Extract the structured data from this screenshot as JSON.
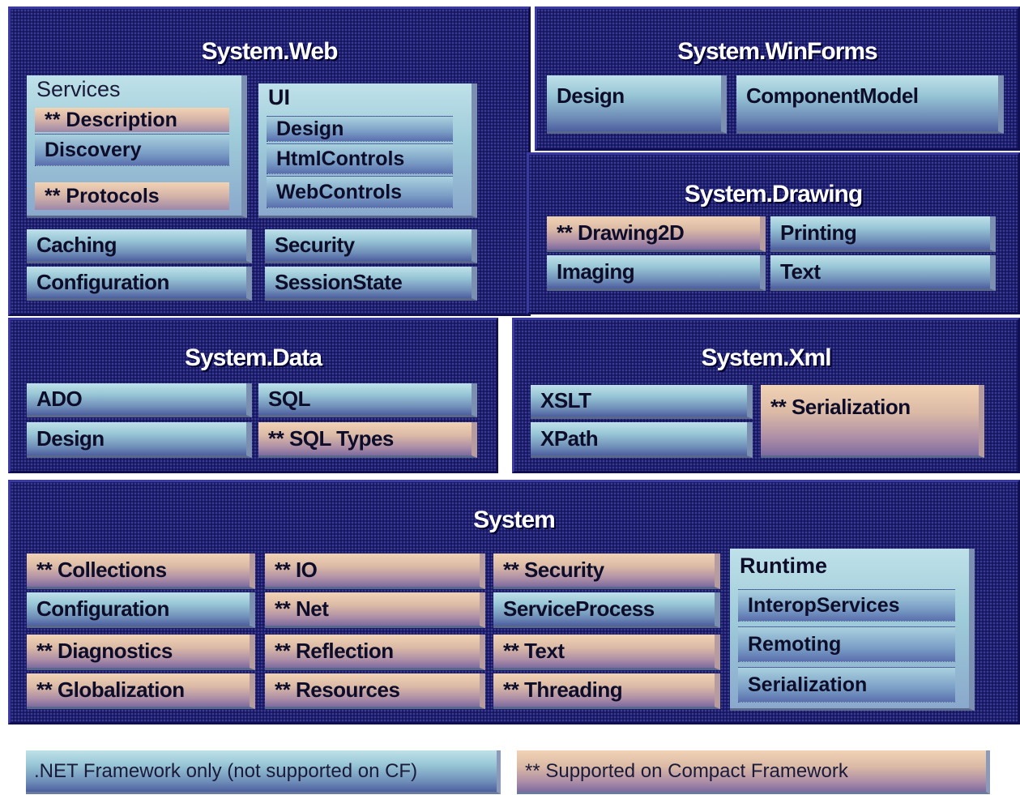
{
  "web": {
    "title": "System.Web",
    "services": {
      "title": "Services",
      "description": "** Description",
      "discovery": "Discovery",
      "protocols": "** Protocols"
    },
    "ui": {
      "title": "UI",
      "design": "Design",
      "html_controls": "HtmlControls",
      "web_controls": "WebControls"
    },
    "caching": "Caching",
    "configuration": "Configuration",
    "security": "Security",
    "session_state": "SessionState"
  },
  "winforms": {
    "title": "System.WinForms",
    "design": "Design",
    "component_model": "ComponentModel"
  },
  "drawing": {
    "title": "System.Drawing",
    "drawing2d": "** Drawing2D",
    "printing": "Printing",
    "imaging": "Imaging",
    "text": "Text"
  },
  "data": {
    "title": "System.Data",
    "ado": "ADO",
    "sql": "SQL",
    "design": "Design",
    "sql_types": "** SQL Types"
  },
  "xml": {
    "title": "System.Xml",
    "xslt": "XSLT",
    "xpath": "XPath",
    "serialization": "** Serialization"
  },
  "system": {
    "title": "System",
    "col1": [
      "** Collections",
      "Configuration",
      "** Diagnostics",
      "** Globalization"
    ],
    "col2": [
      "** IO",
      "** Net",
      "** Reflection",
      "** Resources"
    ],
    "col3": [
      "** Security",
      "ServiceProcess",
      "** Text",
      "** Threading"
    ],
    "runtime": {
      "title": "Runtime",
      "interop": "InteropServices",
      "remoting": "Remoting",
      "serialization": "Serialization"
    }
  },
  "legend": {
    "net_only": ".NET Framework only (not supported on CF)",
    "compact": "** Supported on Compact Framework"
  },
  "colors": {
    "panel": "#1f1f72",
    "net_only": "#98c6d6",
    "compact": "#dab9a6"
  }
}
